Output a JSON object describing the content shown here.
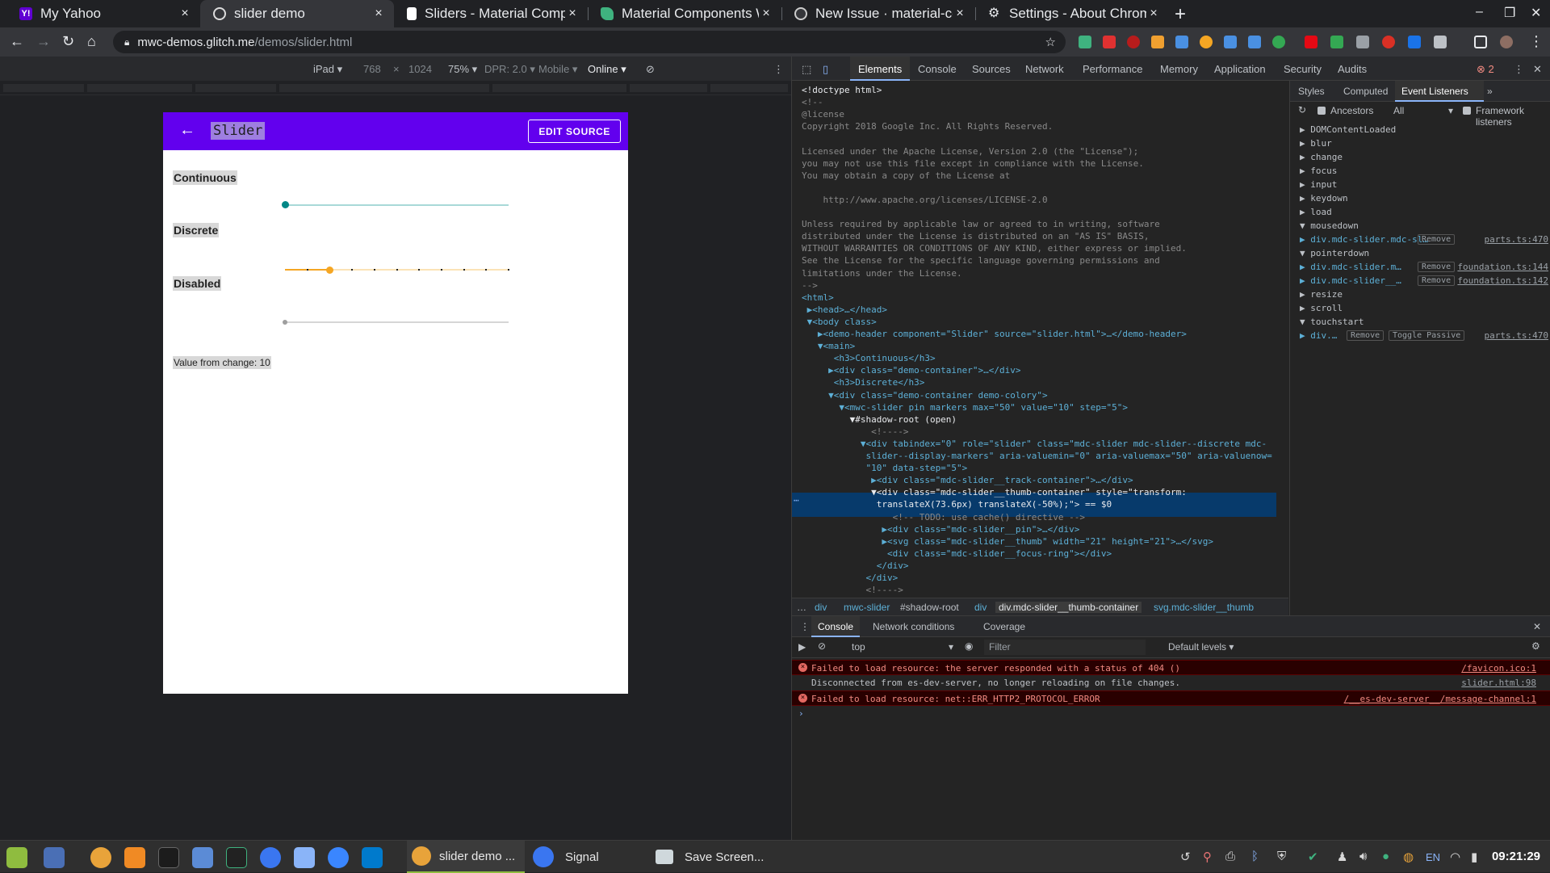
{
  "browser": {
    "tabs": [
      {
        "title": "My Yahoo",
        "favicon_color": "#6001d2",
        "active": false
      },
      {
        "title": "slider demo",
        "favicon_color": "#dcdcdc",
        "active": true
      },
      {
        "title": "Sliders - Material Compo",
        "favicon_color": "#ffffff",
        "active": false
      },
      {
        "title": "Material Components W",
        "favicon_color": "#3fb27f",
        "active": false
      },
      {
        "title": "New Issue · material-con",
        "favicon_color": "#cccccc",
        "active": false
      },
      {
        "title": "Settings - About Chrome",
        "favicon_color": "#e8eaed",
        "active": false
      }
    ],
    "new_tab": "+",
    "close_glyph": "×",
    "url_host": "mwc-demos.glitch.me",
    "url_path": "/demos/slider.html"
  },
  "device_toolbar": {
    "device": "iPad ▾",
    "width": "768",
    "times": "×",
    "height": "1024",
    "zoom": "75% ▾",
    "dpr": "DPR: 2.0 ▾",
    "mode": "Mobile ▾",
    "network": "Online ▾"
  },
  "page": {
    "title": "Slider",
    "edit_source": "EDIT SOURCE",
    "back_glyph": "←",
    "sections": {
      "continuous": "Continuous",
      "discrete": "Discrete",
      "disabled": "Disabled"
    },
    "value_text": "Value from change: 10",
    "continuous_value": 0,
    "discrete_value": 10,
    "discrete_max": 50,
    "discrete_step": 5,
    "disabled_value": 0,
    "colors": {
      "appbar": "#6200ee",
      "continuous": "#018786",
      "discrete": "#f5a623",
      "disabled": "#9e9e9e"
    }
  },
  "devtools": {
    "tabs": [
      "Elements",
      "Console",
      "Sources",
      "Network",
      "Performance",
      "Memory",
      "Application",
      "Security",
      "Audits"
    ],
    "error_count": "2",
    "elements_lines": [
      {
        "c": "txt",
        "t": "<!doctype html>"
      },
      {
        "c": "cmt",
        "t": "<!--"
      },
      {
        "c": "cmt",
        "t": "@license"
      },
      {
        "c": "cmt",
        "t": "Copyright 2018 Google Inc. All Rights Reserved."
      },
      {
        "c": "cmt",
        "t": ""
      },
      {
        "c": "cmt",
        "t": "Licensed under the Apache License, Version 2.0 (the \"License\");"
      },
      {
        "c": "cmt",
        "t": "you may not use this file except in compliance with the License."
      },
      {
        "c": "cmt",
        "t": "You may obtain a copy of the License at"
      },
      {
        "c": "cmt",
        "t": ""
      },
      {
        "c": "cmt",
        "t": "    http://www.apache.org/licenses/LICENSE-2.0"
      },
      {
        "c": "cmt",
        "t": ""
      },
      {
        "c": "cmt",
        "t": "Unless required by applicable law or agreed to in writing, software"
      },
      {
        "c": "cmt",
        "t": "distributed under the License is distributed on an \"AS IS\" BASIS,"
      },
      {
        "c": "cmt",
        "t": "WITHOUT WARRANTIES OR CONDITIONS OF ANY KIND, either express or implied."
      },
      {
        "c": "cmt",
        "t": "See the License for the specific language governing permissions and"
      },
      {
        "c": "cmt",
        "t": "limitations under the License."
      },
      {
        "c": "cmt",
        "t": "-->"
      },
      {
        "c": "tag",
        "t": "<html>"
      },
      {
        "c": "tag",
        "t": " ▶<head>…</head>"
      },
      {
        "c": "tag",
        "t": " ▼<body class>"
      },
      {
        "c": "tag",
        "t": "   ▶<demo-header component=\"Slider\" source=\"slider.html\">…</demo-header>"
      },
      {
        "c": "tag",
        "t": "   ▼<main>"
      },
      {
        "c": "tag",
        "t": "      <h3>Continuous</h3>"
      },
      {
        "c": "tag",
        "t": "     ▶<div class=\"demo-container\">…</div>"
      },
      {
        "c": "tag",
        "t": "      <h3>Discrete</h3>"
      },
      {
        "c": "tag",
        "t": "     ▼<div class=\"demo-container demo-colory\">"
      },
      {
        "c": "tag",
        "t": "       ▼<mwc-slider pin markers max=\"50\" value=\"10\" step=\"5\">"
      },
      {
        "c": "txt",
        "t": "         ▼#shadow-root (open)"
      },
      {
        "c": "cmt",
        "t": "             <!---->"
      },
      {
        "c": "tag",
        "t": "           ▼<div tabindex=\"0\" role=\"slider\" class=\"mdc-slider mdc-slider--discrete mdc-"
      },
      {
        "c": "tag",
        "t": "            slider--display-markers\" aria-valuemin=\"0\" aria-valuemax=\"50\" aria-valuenow="
      },
      {
        "c": "tag",
        "t": "            \"10\" data-step=\"5\">"
      },
      {
        "c": "tag",
        "t": "             ▶<div class=\"mdc-slider__track-container\">…</div>"
      },
      {
        "c": "tag",
        "t": "             ▼<div class=\"mdc-slider__thumb-container\" style=\"transform:"
      },
      {
        "c": "tag",
        "t": "              translateX(73.6px) translateX(-50%);\"> == $0"
      },
      {
        "c": "cmt",
        "t": "                 <!-- TODO: use cache() directive -->"
      },
      {
        "c": "tag",
        "t": "               ▶<div class=\"mdc-slider__pin\">…</div>"
      },
      {
        "c": "tag",
        "t": "               ▶<svg class=\"mdc-slider__thumb\" width=\"21\" height=\"21\">…</svg>"
      },
      {
        "c": "tag",
        "t": "                <div class=\"mdc-slider__focus-ring\"></div>"
      },
      {
        "c": "tag",
        "t": "              </div>"
      },
      {
        "c": "tag",
        "t": "            </div>"
      },
      {
        "c": "cmt",
        "t": "            <!---->"
      },
      {
        "c": "tag",
        "t": "        </mwc-slider>"
      },
      {
        "c": "tag",
        "t": "      </div>"
      }
    ],
    "breadcrumbs": [
      "…",
      "div",
      "mwc-slider",
      "#shadow-root",
      "div",
      "div.mdc-slider__thumb-container",
      "svg.mdc-slider__thumb"
    ],
    "side_tabs": [
      "Styles",
      "Computed",
      "Event Listeners",
      "»"
    ],
    "ev_toolbar": {
      "ancestors": "Ancestors",
      "filter": "All",
      "framework": "Framework listeners"
    },
    "events": [
      {
        "name": "▶ DOMContentLoaded"
      },
      {
        "name": "▶ blur"
      },
      {
        "name": "▶ change"
      },
      {
        "name": "▶ focus"
      },
      {
        "name": "▶ input"
      },
      {
        "name": "▶ keydown"
      },
      {
        "name": "▶ load"
      },
      {
        "name": "▼ mousedown"
      },
      {
        "name": "    ▶ div.mdc-slider.mdc-sl…",
        "remove": "Remove",
        "src": "parts.ts:470"
      },
      {
        "name": "▼ pointerdown"
      },
      {
        "name": "    ▶ div.mdc-slider.m…",
        "remove": "Remove",
        "src": "foundation.ts:144"
      },
      {
        "name": "    ▶ div.mdc-slider__…",
        "remove": "Remove",
        "src": "foundation.ts:142"
      },
      {
        "name": "▶ resize"
      },
      {
        "name": "▶ scroll"
      },
      {
        "name": "▼ touchstart"
      },
      {
        "name": "    ▶ div.…",
        "remove": "Remove",
        "toggle": "Toggle Passive",
        "src": "parts.ts:470"
      }
    ],
    "drawer_tabs": [
      "Console",
      "Network conditions",
      "Coverage"
    ],
    "console_context": "top",
    "console_filter": "Filter",
    "levels": "Default levels ▾",
    "messages": [
      {
        "type": "err",
        "text": "Failed to load resource: the server responded with a status of 404 ()",
        "src": "/favicon.ico:1"
      },
      {
        "type": "log",
        "text": "Disconnected from es-dev-server, no longer reloading on file changes.",
        "src": "slider.html:98"
      },
      {
        "type": "err",
        "text": "Failed to load resource: net::ERR_HTTP2_PROTOCOL_ERROR",
        "src": "/__es-dev-server__/message-channel:1"
      }
    ],
    "prompt": "›"
  },
  "taskbar": {
    "windows": [
      {
        "title": "slider demo ...",
        "active": true
      },
      {
        "title": "Signal",
        "active": false
      },
      {
        "title": "Save Screen...",
        "active": false
      }
    ],
    "lang": "EN",
    "clock": "09:21:29"
  }
}
